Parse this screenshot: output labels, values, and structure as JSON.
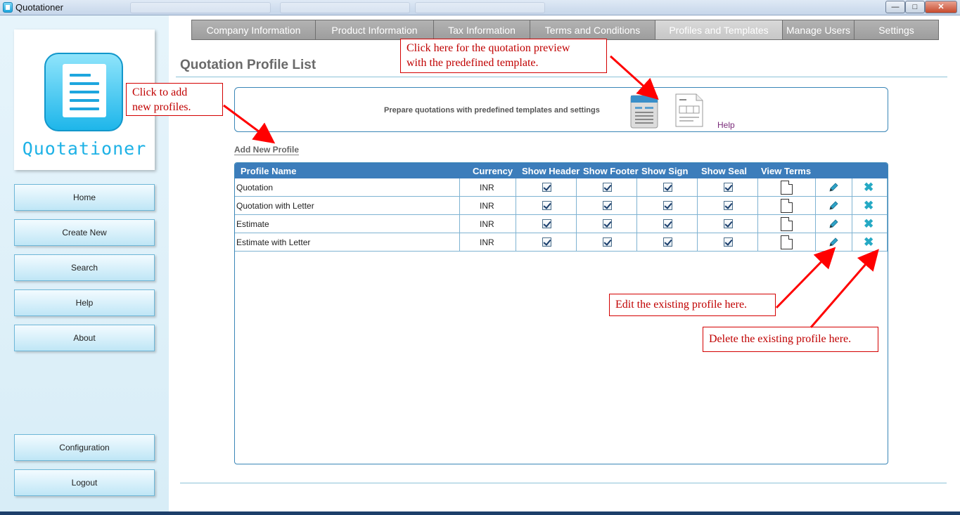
{
  "window": {
    "title": "Quotationer",
    "controls": [
      "minimize",
      "maximize",
      "close"
    ]
  },
  "sidebar": {
    "logo_text": "Quotationer",
    "nav": [
      "Home",
      "Create New",
      "Search",
      "Help",
      "About"
    ],
    "bottom_nav": [
      "Configuration",
      "Logout"
    ]
  },
  "tabs": [
    {
      "label": "Company Information",
      "active": false
    },
    {
      "label": "Product Information",
      "active": false
    },
    {
      "label": "Tax Information",
      "active": false
    },
    {
      "label": "Terms and Conditions",
      "active": false
    },
    {
      "label": "Profiles and Templates",
      "active": true
    },
    {
      "label": "Manage Users",
      "active": false
    },
    {
      "label": "Settings",
      "active": false
    }
  ],
  "page": {
    "title": "Quotation Profile List",
    "template_text": "Prepare quotations with predefined templates and settings",
    "help_label": "Help",
    "add_profile_label": "Add New Profile"
  },
  "grid": {
    "columns": [
      "Profile Name",
      "Currency",
      "Show Header",
      "Show Footer",
      "Show Sign",
      "Show Seal",
      "View Terms"
    ],
    "rows": [
      {
        "name": "Quotation",
        "currency": "INR",
        "header": true,
        "footer": true,
        "sign": true,
        "seal": true
      },
      {
        "name": "Quotation with Letter",
        "currency": "INR",
        "header": true,
        "footer": true,
        "sign": true,
        "seal": true
      },
      {
        "name": "Estimate",
        "currency": "INR",
        "header": true,
        "footer": true,
        "sign": true,
        "seal": true
      },
      {
        "name": "Estimate with Letter",
        "currency": "INR",
        "header": true,
        "footer": true,
        "sign": true,
        "seal": true
      }
    ]
  },
  "callouts": {
    "preview": "Click here for the quotation preview with the predefined template.",
    "preview_line1": "Click here for the quotation preview",
    "preview_line2": "with the predefined template.",
    "add_line1": "Click to add",
    "add_line2": "new profiles.",
    "edit": "Edit the existing profile here.",
    "delete": "Delete the existing profile here."
  },
  "colors": {
    "accent": "#3c7dbb",
    "sidebar_bg": "#e6f4fb",
    "callout_red": "#d40000",
    "delete_icon": "#25a9c4"
  }
}
